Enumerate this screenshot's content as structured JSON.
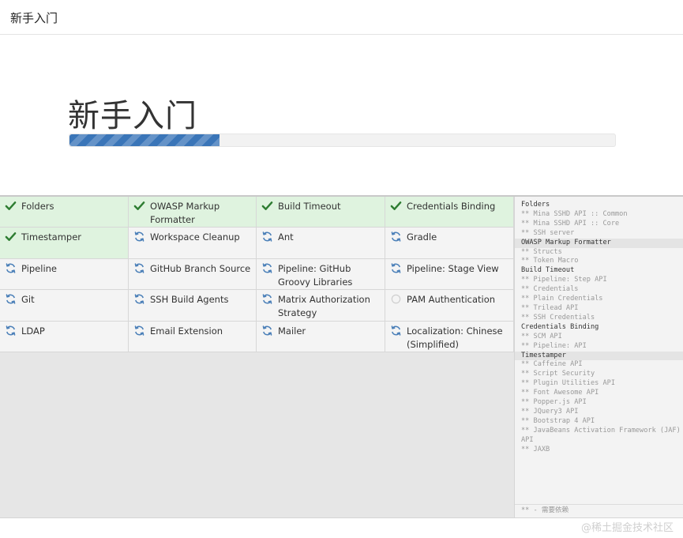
{
  "header": {
    "title": "新手入门"
  },
  "hero": {
    "heading": "新手入门",
    "progress": 0.275,
    "progress_color": "#3a75b8"
  },
  "plugins": [
    {
      "name": "Folders",
      "status": "success"
    },
    {
      "name": "OWASP Markup Formatter",
      "status": "success"
    },
    {
      "name": "Build Timeout",
      "status": "success"
    },
    {
      "name": "Credentials Binding",
      "status": "success"
    },
    {
      "name": "Timestamper",
      "status": "success"
    },
    {
      "name": "Workspace Cleanup",
      "status": "installing"
    },
    {
      "name": "Ant",
      "status": "installing"
    },
    {
      "name": "Gradle",
      "status": "installing"
    },
    {
      "name": "Pipeline",
      "status": "installing"
    },
    {
      "name": "GitHub Branch Source",
      "status": "installing"
    },
    {
      "name": "Pipeline: GitHub Groovy Libraries",
      "status": "installing"
    },
    {
      "name": "Pipeline: Stage View",
      "status": "installing"
    },
    {
      "name": "Git",
      "status": "installing"
    },
    {
      "name": "SSH Build Agents",
      "status": "installing"
    },
    {
      "name": "Matrix Authorization Strategy",
      "status": "installing"
    },
    {
      "name": "PAM Authentication",
      "status": "pending"
    },
    {
      "name": "LDAP",
      "status": "installing"
    },
    {
      "name": "Email Extension",
      "status": "installing"
    },
    {
      "name": "Mailer",
      "status": "installing"
    },
    {
      "name": "Localization: Chinese (Simplified)",
      "status": "installing"
    }
  ],
  "status_colors": {
    "success": "#2e7d32",
    "installing": "#4a7fb8",
    "pending": "#cfcfcf"
  },
  "log": [
    {
      "text": "Folders",
      "type": "header",
      "dark": false
    },
    {
      "text": "** Mina SSHD API :: Common",
      "type": "dep"
    },
    {
      "text": "** Mina SSHD API :: Core",
      "type": "dep"
    },
    {
      "text": "** SSH server",
      "type": "dep"
    },
    {
      "text": "OWASP Markup Formatter",
      "type": "header",
      "dark": true
    },
    {
      "text": "** Structs",
      "type": "dep"
    },
    {
      "text": "** Token Macro",
      "type": "dep"
    },
    {
      "text": "Build Timeout",
      "type": "header",
      "dark": false
    },
    {
      "text": "** Pipeline: Step API",
      "type": "dep"
    },
    {
      "text": "** Credentials",
      "type": "dep"
    },
    {
      "text": "** Plain Credentials",
      "type": "dep"
    },
    {
      "text": "** Trilead API",
      "type": "dep"
    },
    {
      "text": "** SSH Credentials",
      "type": "dep"
    },
    {
      "text": "Credentials Binding",
      "type": "header",
      "dark": false
    },
    {
      "text": "** SCM API",
      "type": "dep"
    },
    {
      "text": "** Pipeline: API",
      "type": "dep"
    },
    {
      "text": "Timestamper",
      "type": "header",
      "dark": true
    },
    {
      "text": "** Caffeine API",
      "type": "dep"
    },
    {
      "text": "** Script Security",
      "type": "dep"
    },
    {
      "text": "** Plugin Utilities API",
      "type": "dep"
    },
    {
      "text": "** Font Awesome API",
      "type": "dep"
    },
    {
      "text": "** Popper.js API",
      "type": "dep"
    },
    {
      "text": "** JQuery3 API",
      "type": "dep"
    },
    {
      "text": "** Bootstrap 4 API",
      "type": "dep"
    },
    {
      "text": "** JavaBeans Activation Framework (JAF)",
      "type": "dep"
    },
    {
      "text": "API",
      "type": "dep"
    },
    {
      "text": "** JAXB",
      "type": "dep"
    }
  ],
  "legend": "** - 需要依赖",
  "watermark": "@稀土掘金技术社区"
}
